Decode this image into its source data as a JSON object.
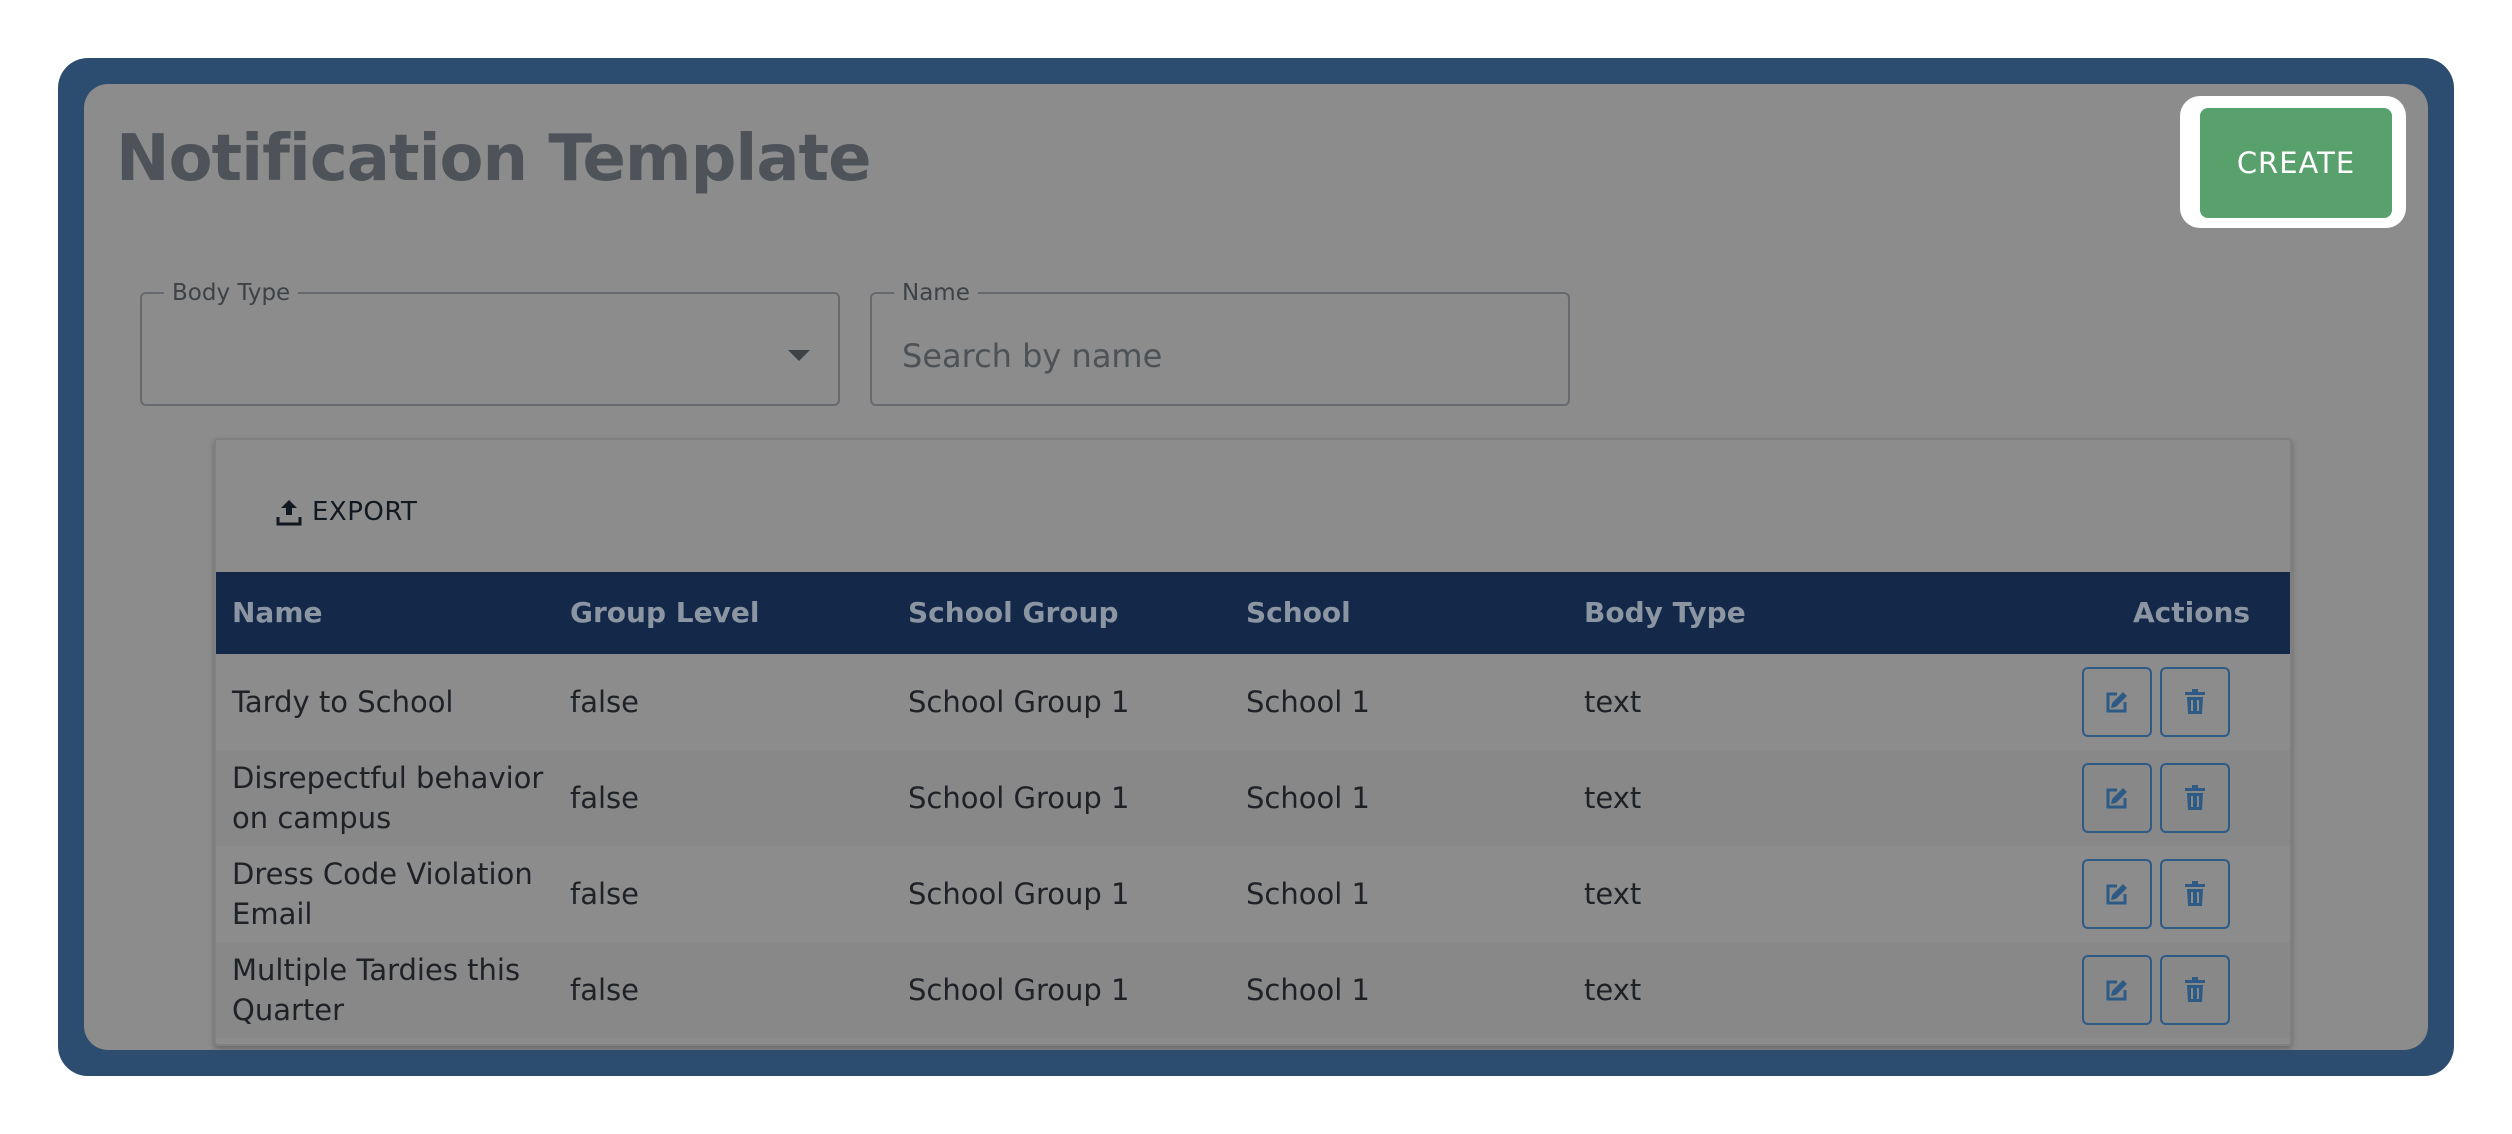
{
  "page": {
    "title": "Notification Template",
    "create_label": "CREATE"
  },
  "filters": {
    "body_type": {
      "label": "Body Type",
      "value": ""
    },
    "name": {
      "label": "Name",
      "placeholder": "Search by name",
      "value": ""
    }
  },
  "toolbar": {
    "export_label": "EXPORT"
  },
  "table": {
    "columns": [
      "Name",
      "Group Level",
      "School Group",
      "School",
      "Body Type",
      "Actions"
    ],
    "rows": [
      {
        "name": "Tardy to School",
        "group_level": "false",
        "school_group": "School Group 1",
        "school": "School 1",
        "body_type": "text"
      },
      {
        "name": "Disrepectful behavior on campus",
        "group_level": "false",
        "school_group": "School Group 1",
        "school": "School 1",
        "body_type": "text"
      },
      {
        "name": "Dress Code Violation Email",
        "group_level": "false",
        "school_group": "School Group 1",
        "school": "School 1",
        "body_type": "text"
      },
      {
        "name": "Multiple Tardies this Quarter",
        "group_level": "false",
        "school_group": "School Group 1",
        "school": "School 1",
        "body_type": "text"
      }
    ],
    "row_actions": {
      "edit_icon": "edit-icon",
      "delete_icon": "trash-icon"
    }
  },
  "colors": {
    "frame": "#2c4d6f",
    "overlay": "#8c8c8c",
    "create_button": "#58a06c",
    "table_header": "#14294a",
    "action_outline": "#2e5a86"
  }
}
